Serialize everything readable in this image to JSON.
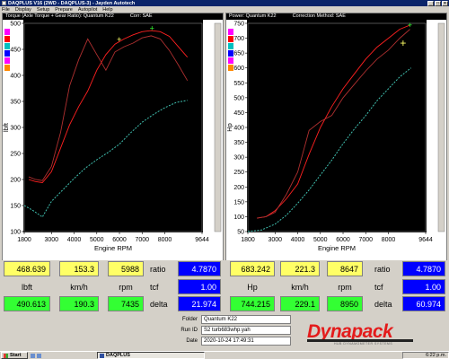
{
  "window": {
    "title": "DAQPLUS V16 (2WD - DAQPLUS-3) - Jayden Autotech"
  },
  "menu": [
    "File",
    "Display",
    "Setup",
    "Prepare",
    "Autopilot",
    "Help"
  ],
  "left_panel": {
    "title_a": "Torque (Axle Torque + Gear Ratio): Quantum K22",
    "title_b": "Corr: SAE",
    "y_axis_label": "lbft",
    "x_axis_label": "Engine RPM",
    "y_ticks": [
      "500",
      "450",
      "400",
      "350",
      "300",
      "250",
      "200",
      "150",
      "100"
    ],
    "x_ticks": [
      "1800",
      "3000",
      "4000",
      "5000",
      "6000",
      "7000",
      "8000",
      "9644"
    ]
  },
  "right_panel": {
    "title_a": "Power: Quantum K22",
    "title_b": "Correction Method: SAE",
    "y_axis_label": "Hp",
    "x_axis_label": "Engine RPM",
    "y_ticks": [
      "750",
      "700",
      "650",
      "600",
      "550",
      "500",
      "450",
      "400",
      "350",
      "300",
      "250",
      "200",
      "150",
      "100",
      "50"
    ],
    "x_ticks": [
      "1800",
      "3000",
      "4000",
      "5000",
      "6000",
      "7000",
      "8000",
      "9644"
    ]
  },
  "legend_colors": [
    "#ff00ff",
    "#ff0000",
    "#00c0c0",
    "#0000ff",
    "#ff00ff",
    "#ff8800"
  ],
  "left_readout": {
    "row1": [
      "468.639",
      "153.3",
      "5988"
    ],
    "row2": [
      "lbft",
      "km/h",
      "rpm"
    ],
    "row3": [
      "490.613",
      "190.3",
      "7435"
    ],
    "labels": [
      "ratio",
      "tcf",
      "delta"
    ],
    "values": [
      "4.7870",
      "1.00",
      "21.974"
    ]
  },
  "right_readout": {
    "row1": [
      "683.242",
      "221.3",
      "8647"
    ],
    "row2": [
      "Hp",
      "km/h",
      "rpm"
    ],
    "row3": [
      "744.215",
      "229.1",
      "8950"
    ],
    "labels": [
      "ratio",
      "tcf",
      "delta"
    ],
    "values": [
      "4.7870",
      "1.00",
      "60.974"
    ]
  },
  "info": {
    "folder_label": "Folder",
    "folder": "Quantum K22",
    "runid_label": "Run ID",
    "runid": "S2 turb683whp.yah",
    "date_label": "Date",
    "date": "2020-10-24  17:49:31"
  },
  "brand": {
    "name": "Dynapack",
    "tagline": "HUB DYNAMOMETER SYSTEMS"
  },
  "taskbar": {
    "start": "Start",
    "app": "DAQPLUS",
    "clock": "6:22 p.m."
  },
  "chart_data": [
    {
      "type": "line",
      "title": "Torque (Axle Torque + Gear Ratio): Quantum K22",
      "xlabel": "Engine RPM",
      "ylabel": "lbft",
      "xlim": [
        1800,
        9644
      ],
      "ylim": [
        100,
        500
      ],
      "series": [
        {
          "color": "#ff2020",
          "x": [
            2000,
            2300,
            2600,
            3000,
            3400,
            3800,
            4200,
            4600,
            5000,
            5400,
            5800,
            6200,
            6600,
            7000,
            7400,
            7800,
            8200,
            8600,
            9000
          ],
          "y": [
            200,
            196,
            194,
            215,
            260,
            305,
            340,
            370,
            410,
            440,
            460,
            470,
            478,
            484,
            486,
            484,
            475,
            455,
            435
          ]
        },
        {
          "color": "#b03030",
          "x": [
            2000,
            2300,
            2600,
            3000,
            3400,
            3800,
            4200,
            4600,
            5000,
            5400,
            5800,
            6200,
            6600,
            7000,
            7400,
            7800,
            8200,
            8600,
            9000
          ],
          "y": [
            205,
            200,
            198,
            225,
            290,
            380,
            430,
            470,
            440,
            410,
            445,
            455,
            462,
            472,
            476,
            470,
            448,
            420,
            390
          ]
        },
        {
          "color": "#40c0b0",
          "x": [
            1800,
            2200,
            2600,
            3000,
            3500,
            4000,
            4500,
            5000,
            5500,
            6000,
            6500,
            7000,
            7500,
            8000,
            8500,
            9000
          ],
          "y": [
            150,
            140,
            128,
            158,
            180,
            202,
            222,
            238,
            252,
            268,
            290,
            310,
            325,
            338,
            348,
            352
          ]
        }
      ]
    },
    {
      "type": "line",
      "title": "Power: Quantum K22",
      "xlabel": "Engine RPM",
      "ylabel": "Hp",
      "xlim": [
        1800,
        9644
      ],
      "ylim": [
        50,
        750
      ],
      "series": [
        {
          "color": "#ff2020",
          "x": [
            2200,
            2600,
            3000,
            3500,
            4000,
            4500,
            5000,
            5500,
            6000,
            6500,
            7000,
            7500,
            8000,
            8500,
            8950
          ],
          "y": [
            95,
            100,
            120,
            160,
            210,
            310,
            400,
            470,
            530,
            580,
            630,
            670,
            700,
            730,
            744
          ]
        },
        {
          "color": "#b03030",
          "x": [
            2200,
            2600,
            3000,
            3500,
            4000,
            4500,
            5000,
            5500,
            6000,
            6500,
            7000,
            7500,
            8000,
            8500,
            8950
          ],
          "y": [
            95,
            100,
            115,
            175,
            250,
            390,
            420,
            440,
            500,
            545,
            590,
            630,
            660,
            700,
            730
          ]
        },
        {
          "color": "#40c0b0",
          "x": [
            1800,
            2400,
            3000,
            3500,
            4000,
            4500,
            5000,
            5500,
            6000,
            6500,
            7000,
            7500,
            8000,
            8500,
            9000
          ],
          "y": [
            50,
            55,
            75,
            105,
            145,
            190,
            240,
            290,
            345,
            395,
            440,
            490,
            530,
            570,
            600
          ]
        }
      ]
    }
  ]
}
